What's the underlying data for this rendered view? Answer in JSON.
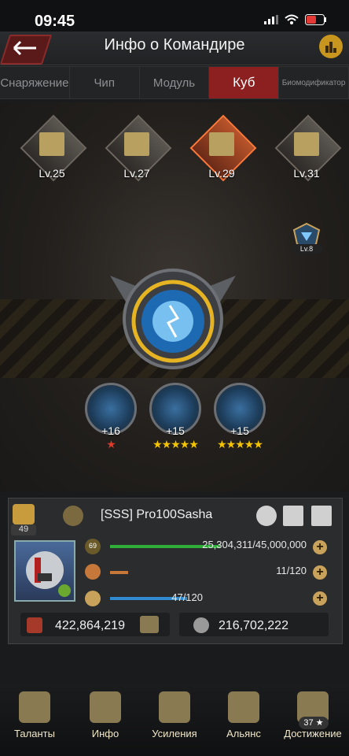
{
  "status": {
    "time": "09:45"
  },
  "header": {
    "title": "Инфо о Командире"
  },
  "tabs": [
    {
      "label": "Снаряжение"
    },
    {
      "label": "Чип"
    },
    {
      "label": "Модуль"
    },
    {
      "label": "Куб"
    },
    {
      "label": "Биомодификатор"
    }
  ],
  "buildings": [
    {
      "label": "Lv.25"
    },
    {
      "label": "Lv.27"
    },
    {
      "label": "Lv.29"
    },
    {
      "label": "Lv.31"
    }
  ],
  "core": {
    "level_badge": "Lv.8"
  },
  "cubes": [
    {
      "value": "+16",
      "stars": "★"
    },
    {
      "value": "+15",
      "stars": "★★★★★"
    },
    {
      "value": "+15",
      "stars": "★★★★★"
    }
  ],
  "commander": {
    "rank_level": "49",
    "name": "[SSS]  Pro100Sasha",
    "avatar_level": "69",
    "rows": [
      {
        "text": "25,304,311/45,000,000",
        "progress": 0.56,
        "color": "#2fae3a"
      },
      {
        "text": "11/120",
        "progress": 0.09,
        "color": "#c6783a"
      },
      {
        "text": "47/120",
        "progress": 0.39,
        "color": "#2f8ad0"
      }
    ],
    "power": "422,864,219",
    "kills": "216,702,222"
  },
  "nav": [
    {
      "label": "Таланты"
    },
    {
      "label": "Инфо"
    },
    {
      "label": "Усиления"
    },
    {
      "label": "Альянс"
    },
    {
      "label": "Достижение"
    }
  ],
  "achievement_badge": "37 ★"
}
